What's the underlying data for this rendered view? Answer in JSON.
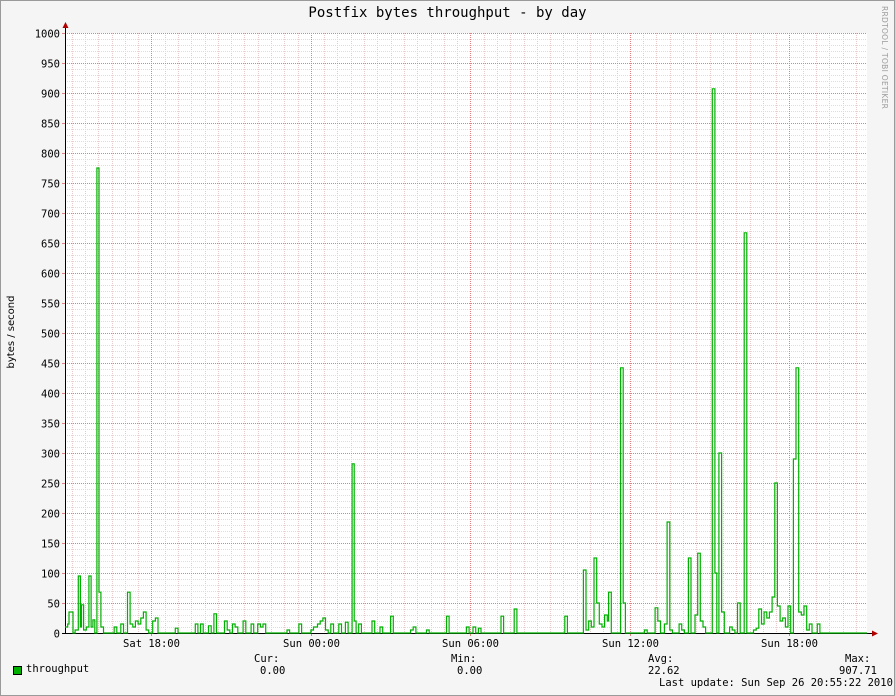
{
  "chart_data": {
    "type": "line",
    "title": "Postfix bytes throughput - by day",
    "ylabel": "bytes / second",
    "xlabel": "",
    "ylim": [
      0,
      1000
    ],
    "yticks": [
      0,
      50,
      100,
      150,
      200,
      250,
      300,
      350,
      400,
      450,
      500,
      550,
      600,
      650,
      700,
      750,
      800,
      850,
      900,
      950,
      1000
    ],
    "x_start": "Sat 14:45",
    "x_end": "Sun 20:55",
    "x_unit": "hours since Sat 14:45",
    "xlim": [
      0,
      30.17
    ],
    "xticks": [
      {
        "label": "Sat 18:00",
        "x": 3.25
      },
      {
        "label": "Sun 00:00",
        "x": 9.25
      },
      {
        "label": "Sun 06:00",
        "x": 15.25
      },
      {
        "label": "Sun 12:00",
        "x": 21.25
      },
      {
        "label": "Sun 18:00",
        "x": 27.25
      }
    ],
    "grid": true,
    "series": [
      {
        "name": "throughput",
        "color": "#00b000",
        "points": [
          [
            0.0,
            10
          ],
          [
            0.1,
            15
          ],
          [
            0.15,
            35
          ],
          [
            0.3,
            0
          ],
          [
            0.38,
            5
          ],
          [
            0.45,
            5
          ],
          [
            0.5,
            95
          ],
          [
            0.58,
            10
          ],
          [
            0.62,
            47
          ],
          [
            0.7,
            5
          ],
          [
            0.8,
            10
          ],
          [
            0.9,
            95
          ],
          [
            0.98,
            10
          ],
          [
            1.05,
            22
          ],
          [
            1.12,
            0
          ],
          [
            1.2,
            775
          ],
          [
            1.28,
            68
          ],
          [
            1.35,
            10
          ],
          [
            1.45,
            0
          ],
          [
            1.7,
            0
          ],
          [
            1.85,
            10
          ],
          [
            1.95,
            0
          ],
          [
            2.1,
            15
          ],
          [
            2.2,
            0
          ],
          [
            2.35,
            68
          ],
          [
            2.45,
            15
          ],
          [
            2.55,
            10
          ],
          [
            2.65,
            20
          ],
          [
            2.75,
            15
          ],
          [
            2.85,
            25
          ],
          [
            2.95,
            35
          ],
          [
            3.05,
            5
          ],
          [
            3.15,
            0
          ],
          [
            3.3,
            20
          ],
          [
            3.4,
            25
          ],
          [
            3.5,
            0
          ],
          [
            4.15,
            8
          ],
          [
            4.25,
            0
          ],
          [
            4.9,
            15
          ],
          [
            5.0,
            0
          ],
          [
            5.1,
            15
          ],
          [
            5.2,
            0
          ],
          [
            5.4,
            12
          ],
          [
            5.5,
            0
          ],
          [
            5.6,
            32
          ],
          [
            5.7,
            0
          ],
          [
            6.0,
            20
          ],
          [
            6.1,
            5
          ],
          [
            6.2,
            0
          ],
          [
            6.3,
            15
          ],
          [
            6.4,
            10
          ],
          [
            6.5,
            0
          ],
          [
            6.7,
            20
          ],
          [
            6.8,
            0
          ],
          [
            7.0,
            15
          ],
          [
            7.1,
            0
          ],
          [
            7.25,
            15
          ],
          [
            7.35,
            10
          ],
          [
            7.45,
            15
          ],
          [
            7.55,
            0
          ],
          [
            8.35,
            5
          ],
          [
            8.45,
            0
          ],
          [
            8.8,
            15
          ],
          [
            8.9,
            0
          ],
          [
            9.25,
            5
          ],
          [
            9.35,
            10
          ],
          [
            9.5,
            15
          ],
          [
            9.6,
            20
          ],
          [
            9.7,
            25
          ],
          [
            9.8,
            5
          ],
          [
            9.9,
            0
          ],
          [
            10.0,
            15
          ],
          [
            10.1,
            0
          ],
          [
            10.3,
            15
          ],
          [
            10.4,
            0
          ],
          [
            10.55,
            18
          ],
          [
            10.65,
            0
          ],
          [
            10.8,
            282
          ],
          [
            10.88,
            20
          ],
          [
            10.95,
            0
          ],
          [
            11.05,
            15
          ],
          [
            11.15,
            0
          ],
          [
            11.55,
            20
          ],
          [
            11.65,
            0
          ],
          [
            11.85,
            10
          ],
          [
            11.95,
            0
          ],
          [
            12.25,
            28
          ],
          [
            12.35,
            0
          ],
          [
            13.0,
            5
          ],
          [
            13.1,
            10
          ],
          [
            13.2,
            0
          ],
          [
            13.6,
            5
          ],
          [
            13.7,
            0
          ],
          [
            14.35,
            28
          ],
          [
            14.45,
            0
          ],
          [
            15.1,
            10
          ],
          [
            15.2,
            0
          ],
          [
            15.35,
            10
          ],
          [
            15.45,
            0
          ],
          [
            15.55,
            8
          ],
          [
            15.65,
            0
          ],
          [
            16.4,
            28
          ],
          [
            16.5,
            0
          ],
          [
            16.9,
            40
          ],
          [
            17.0,
            0
          ],
          [
            18.8,
            28
          ],
          [
            18.9,
            0
          ],
          [
            19.5,
            105
          ],
          [
            19.6,
            5
          ],
          [
            19.7,
            20
          ],
          [
            19.8,
            10
          ],
          [
            19.9,
            125
          ],
          [
            20.0,
            50
          ],
          [
            20.1,
            15
          ],
          [
            20.2,
            10
          ],
          [
            20.3,
            30
          ],
          [
            20.4,
            20
          ],
          [
            20.45,
            68
          ],
          [
            20.55,
            0
          ],
          [
            20.9,
            442
          ],
          [
            21.0,
            50
          ],
          [
            21.08,
            0
          ],
          [
            21.8,
            5
          ],
          [
            21.9,
            0
          ],
          [
            22.2,
            42
          ],
          [
            22.3,
            20
          ],
          [
            22.4,
            0
          ],
          [
            22.55,
            15
          ],
          [
            22.65,
            185
          ],
          [
            22.75,
            5
          ],
          [
            22.85,
            0
          ],
          [
            23.1,
            15
          ],
          [
            23.2,
            5
          ],
          [
            23.3,
            0
          ],
          [
            23.45,
            125
          ],
          [
            23.55,
            0
          ],
          [
            23.7,
            30
          ],
          [
            23.8,
            133
          ],
          [
            23.9,
            20
          ],
          [
            24.0,
            10
          ],
          [
            24.1,
            0
          ],
          [
            24.35,
            907
          ],
          [
            24.45,
            100
          ],
          [
            24.52,
            0
          ],
          [
            24.6,
            300
          ],
          [
            24.7,
            35
          ],
          [
            24.8,
            0
          ],
          [
            25.0,
            10
          ],
          [
            25.1,
            5
          ],
          [
            25.2,
            0
          ],
          [
            25.3,
            50
          ],
          [
            25.4,
            0
          ],
          [
            25.55,
            667
          ],
          [
            25.65,
            0
          ],
          [
            25.9,
            5
          ],
          [
            26.0,
            8
          ],
          [
            26.1,
            40
          ],
          [
            26.2,
            15
          ],
          [
            26.3,
            35
          ],
          [
            26.4,
            25
          ],
          [
            26.5,
            35
          ],
          [
            26.6,
            60
          ],
          [
            26.7,
            250
          ],
          [
            26.8,
            45
          ],
          [
            26.9,
            20
          ],
          [
            27.0,
            25
          ],
          [
            27.1,
            10
          ],
          [
            27.2,
            45
          ],
          [
            27.3,
            0
          ],
          [
            27.4,
            290
          ],
          [
            27.5,
            442
          ],
          [
            27.6,
            35
          ],
          [
            27.7,
            30
          ],
          [
            27.8,
            45
          ],
          [
            27.9,
            5
          ],
          [
            28.0,
            15
          ],
          [
            28.1,
            0
          ],
          [
            28.3,
            15
          ],
          [
            28.4,
            0
          ],
          [
            30.17,
            0
          ]
        ]
      }
    ]
  },
  "vendor_credit": "RRDTOOL / TOBI OETIKER",
  "legend": {
    "series_name": "throughput",
    "cur_label": "Cur:",
    "cur_value": "0.00",
    "min_label": "Min:",
    "min_value": "0.00",
    "avg_label": "Avg:",
    "avg_value": "22.62",
    "max_label": "Max:",
    "max_value": "907.71",
    "last_update": "Last update: Sun Sep 26 20:55:22 2010"
  }
}
